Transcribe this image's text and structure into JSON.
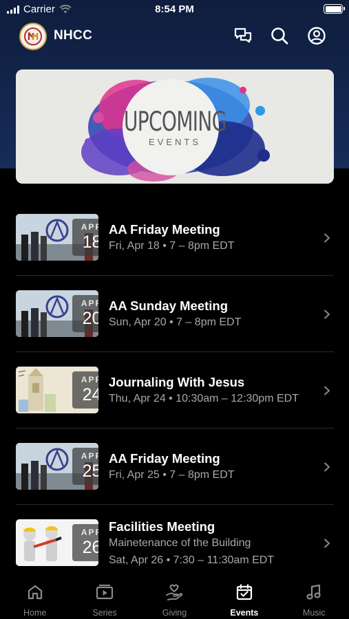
{
  "status_bar": {
    "carrier": "Carrier",
    "time": "8:54 PM"
  },
  "header": {
    "title": "NHCC"
  },
  "hero": {
    "title": "UPCOMING",
    "subtitle": "EVENTS"
  },
  "events": [
    {
      "month": "APR",
      "day": "18",
      "title": "AA Friday Meeting",
      "lines": [
        "Fri, Apr 18 • 7 – 8pm EDT"
      ],
      "thumb": "aa"
    },
    {
      "month": "APR",
      "day": "20",
      "title": "AA Sunday Meeting",
      "lines": [
        "Sun, Apr 20 • 7 – 8pm EDT"
      ],
      "thumb": "aa"
    },
    {
      "month": "APR",
      "day": "24",
      "title": "Journaling With Jesus",
      "lines": [
        "Thu, Apr 24 • 10:30am – 12:30pm EDT"
      ],
      "thumb": "journal"
    },
    {
      "month": "APR",
      "day": "25",
      "title": "AA Friday Meeting",
      "lines": [
        "Fri, Apr 25 • 7 – 8pm EDT"
      ],
      "thumb": "aa"
    },
    {
      "month": "APR",
      "day": "26",
      "title": "Facilities Meeting",
      "lines": [
        "Mainetenance of the Building",
        "Sat, Apr 26 • 7:30 – 11:30am EDT"
      ],
      "thumb": "facilities"
    }
  ],
  "tabs": [
    {
      "label": "Home",
      "icon": "home-icon",
      "active": false
    },
    {
      "label": "Series",
      "icon": "video-play-icon",
      "active": false
    },
    {
      "label": "Giving",
      "icon": "giving-hand-icon",
      "active": false
    },
    {
      "label": "Events",
      "icon": "calendar-icon",
      "active": true
    },
    {
      "label": "Music",
      "icon": "music-note-icon",
      "active": false
    }
  ],
  "colors": {
    "header_bg": "#13264e",
    "background": "#000000",
    "active_tab": "#ffffff",
    "inactive_tab": "#8a8a8a"
  }
}
